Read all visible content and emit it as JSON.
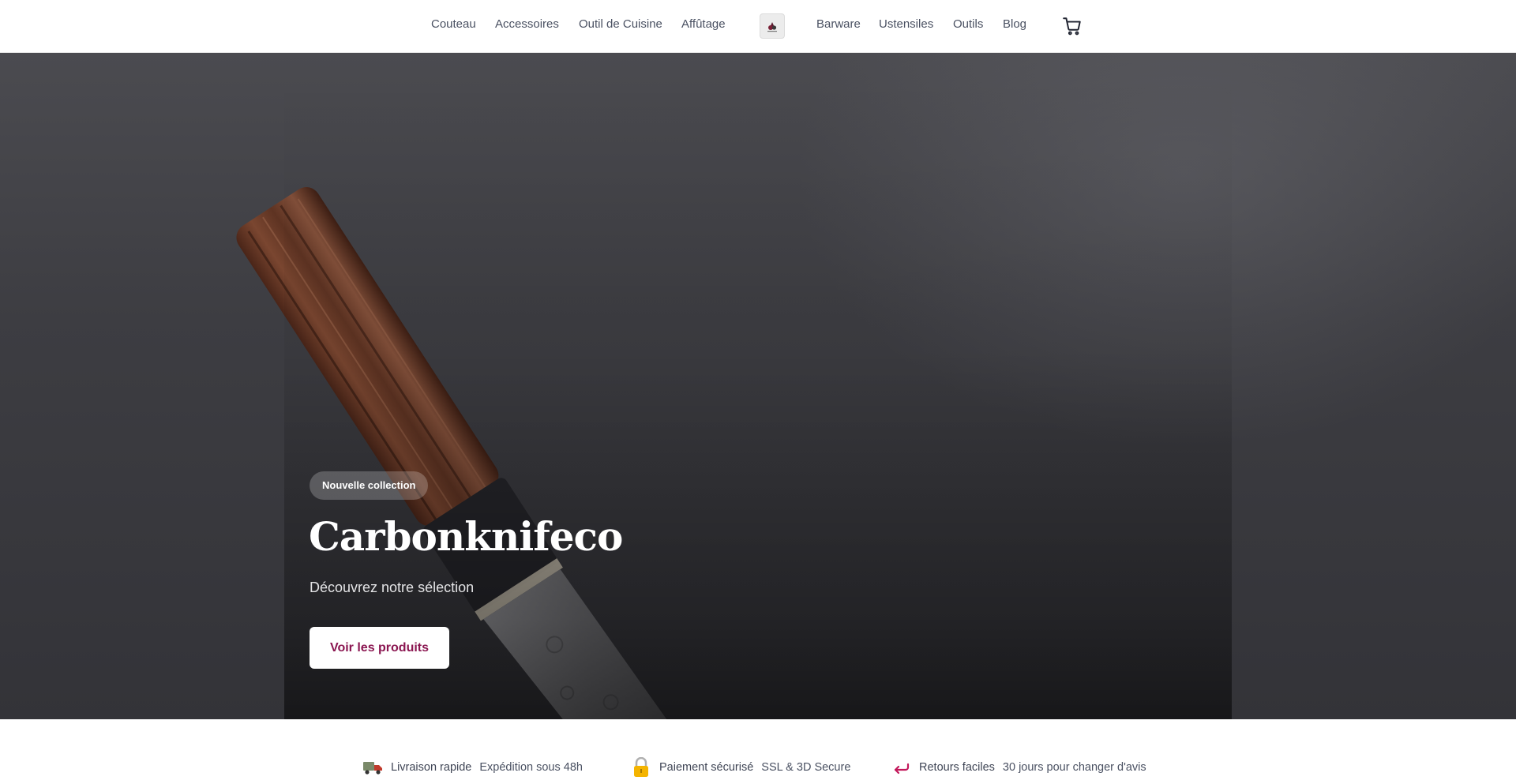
{
  "nav": {
    "left": [
      "Couteau",
      "Accessoires",
      "Outil de Cuisine",
      "Affûtage"
    ],
    "right": [
      "Barware",
      "Ustensiles",
      "Outils",
      "Blog"
    ]
  },
  "hero": {
    "badge": "Nouvelle collection",
    "title": "Carbonknifeco",
    "subtitle": "Découvrez notre sélection",
    "cta": "Voir les produits"
  },
  "features": [
    {
      "icon": "delivery-truck-icon",
      "title": "Livraison rapide",
      "desc": "Expédition sous 48h"
    },
    {
      "icon": "lock-icon",
      "title": "Paiement sécurisé",
      "desc": "SSL & 3D Secure"
    },
    {
      "icon": "return-arrow-icon",
      "title": "Retours faciles",
      "desc": "30 jours pour changer d'avis"
    }
  ],
  "colors": {
    "accent": "#8a1550",
    "nav_text": "#4a5162",
    "hero_bg": "#3d3d42"
  }
}
